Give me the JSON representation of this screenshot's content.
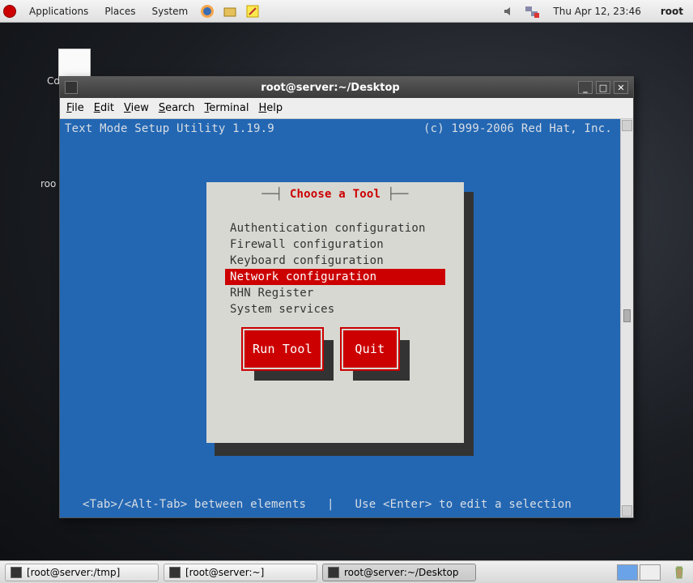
{
  "top_panel": {
    "menus": [
      "Applications",
      "Places",
      "System"
    ],
    "clock": "Thu Apr 12, 23:46",
    "user": "root"
  },
  "desktop": {
    "partial_labels": {
      "co": "Co",
      "roo": "roo"
    }
  },
  "window": {
    "title": "root@server:~/Desktop",
    "menubar": {
      "file": "File",
      "edit": "Edit",
      "view": "View",
      "search": "Search",
      "terminal": "Terminal",
      "help": "Help"
    }
  },
  "terminal": {
    "header_left": "Text Mode Setup Utility 1.19.9",
    "header_right": "(c) 1999-2006 Red Hat, Inc.",
    "dialog": {
      "title": "Choose a Tool",
      "items": [
        "Authentication configuration",
        "Firewall configuration",
        "Keyboard configuration",
        "Network configuration",
        "RHN Register",
        "System services"
      ],
      "selected_index": 3,
      "buttons": {
        "run": "Run Tool",
        "quit": "Quit"
      }
    },
    "footer_left": "<Tab>/<Alt-Tab> between elements",
    "footer_sep": "   |   ",
    "footer_right": "Use <Enter> to edit a selection"
  },
  "taskbar": {
    "tasks": [
      "[root@server:/tmp]",
      "[root@server:~]",
      "root@server:~/Desktop"
    ],
    "active_index": 2
  },
  "window_controls": {
    "min": "_",
    "max": "□",
    "close": "✕"
  }
}
